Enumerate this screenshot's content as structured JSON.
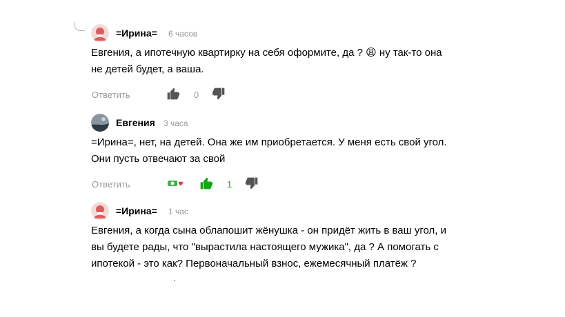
{
  "comments": [
    {
      "author": "=Ирина=",
      "time": "6 часов",
      "text": "Евгения, а ипотечную квартирку на себя оформите, да ? 😩 ну так-то она\nне детей будет, а ваша.",
      "reply_label": "Ответить",
      "likes": "0",
      "avatar_color": "#e05a5a"
    },
    {
      "author": "Евгения",
      "time": "3 часа",
      "text": "=Ирина=, нет, на детей. Она же им приобретается. У меня есть свой угол.\nОни пусть отвечают за свой",
      "reply_label": "Ответить",
      "likes": "1",
      "avatar_color": "#3c4a58"
    },
    {
      "author": "=Ирина=",
      "time": "1 час",
      "text": "Евгения, а когда сына облапошит жёнушка - он придёт жить в ваш угол, и\nвы будете рады, что \"вырастила настоящего мужика\", да ? А помогать с\nипотекой - это как? Первоначальный взнос, ежемесячный платёж ?",
      "avatar_color": "#e05a5a"
    }
  ],
  "colors": {
    "muted": "#999999",
    "icon": "#555555",
    "like_active": "#11a711",
    "reaction_heart": "#e8334a"
  }
}
